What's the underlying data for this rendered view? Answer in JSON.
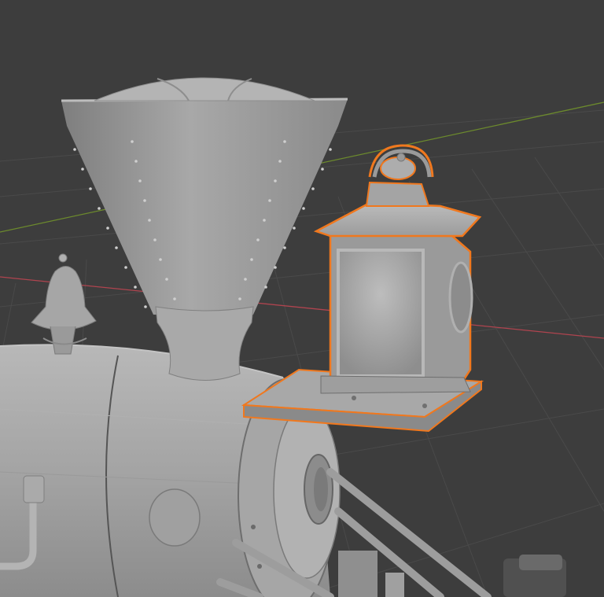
{
  "app": {
    "view": "3d-viewport",
    "shading": "solid"
  },
  "scene": {
    "objects": [
      {
        "name": "smokestack",
        "selected": false
      },
      {
        "name": "bell",
        "selected": false
      },
      {
        "name": "boiler",
        "selected": false
      },
      {
        "name": "smokebox-door",
        "selected": false
      },
      {
        "name": "headlamp",
        "selected": true
      },
      {
        "name": "lamp-bracket",
        "selected": true
      },
      {
        "name": "cowcatcher-rods",
        "selected": false
      }
    ]
  },
  "colors": {
    "background": "#3d3d3d",
    "grid": "#4a4a4a",
    "axis_x": "#b0444f",
    "axis_y": "#6c8a2d",
    "selection_outline": "#f0781e",
    "model": "#9e9e9e"
  }
}
